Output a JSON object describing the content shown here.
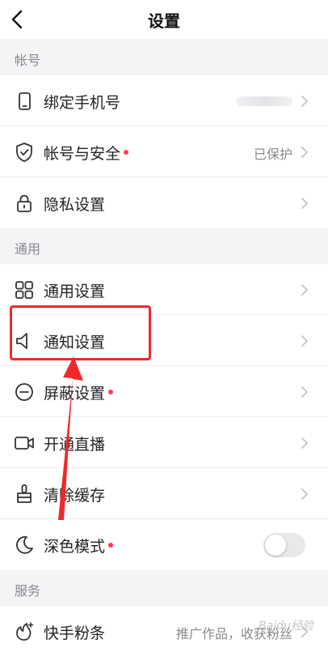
{
  "header": {
    "title": "设置"
  },
  "sections": [
    {
      "label": "帐号",
      "items": [
        {
          "label": "绑定手机号",
          "icon": "phone-icon",
          "value": "",
          "masked": true
        },
        {
          "label": "帐号与安全",
          "icon": "shield-icon",
          "value": "已保护",
          "dot": true
        },
        {
          "label": "隐私设置",
          "icon": "lock-icon",
          "value": ""
        }
      ]
    },
    {
      "label": "通用",
      "items": [
        {
          "label": "通用设置",
          "icon": "grid-icon",
          "value": ""
        },
        {
          "label": "通知设置",
          "icon": "speaker-icon",
          "value": "",
          "highlighted": true
        },
        {
          "label": "屏蔽设置",
          "icon": "block-icon",
          "value": "",
          "dot": true
        },
        {
          "label": "开通直播",
          "icon": "video-icon",
          "value": ""
        },
        {
          "label": "清除缓存",
          "icon": "broom-icon",
          "value": ""
        },
        {
          "label": "深色模式",
          "icon": "moon-icon",
          "dot": true,
          "toggle": {
            "on": false
          }
        }
      ]
    },
    {
      "label": "服务",
      "items": [
        {
          "label": "快手粉条",
          "icon": "fan-boost-icon",
          "value": "推广作品，收获粉丝"
        }
      ]
    }
  ],
  "watermark": "Baidu经验",
  "colors": {
    "accent_dot": "#ff3b5c",
    "annotation": "#f0282c",
    "background": "#f4f4f6"
  }
}
